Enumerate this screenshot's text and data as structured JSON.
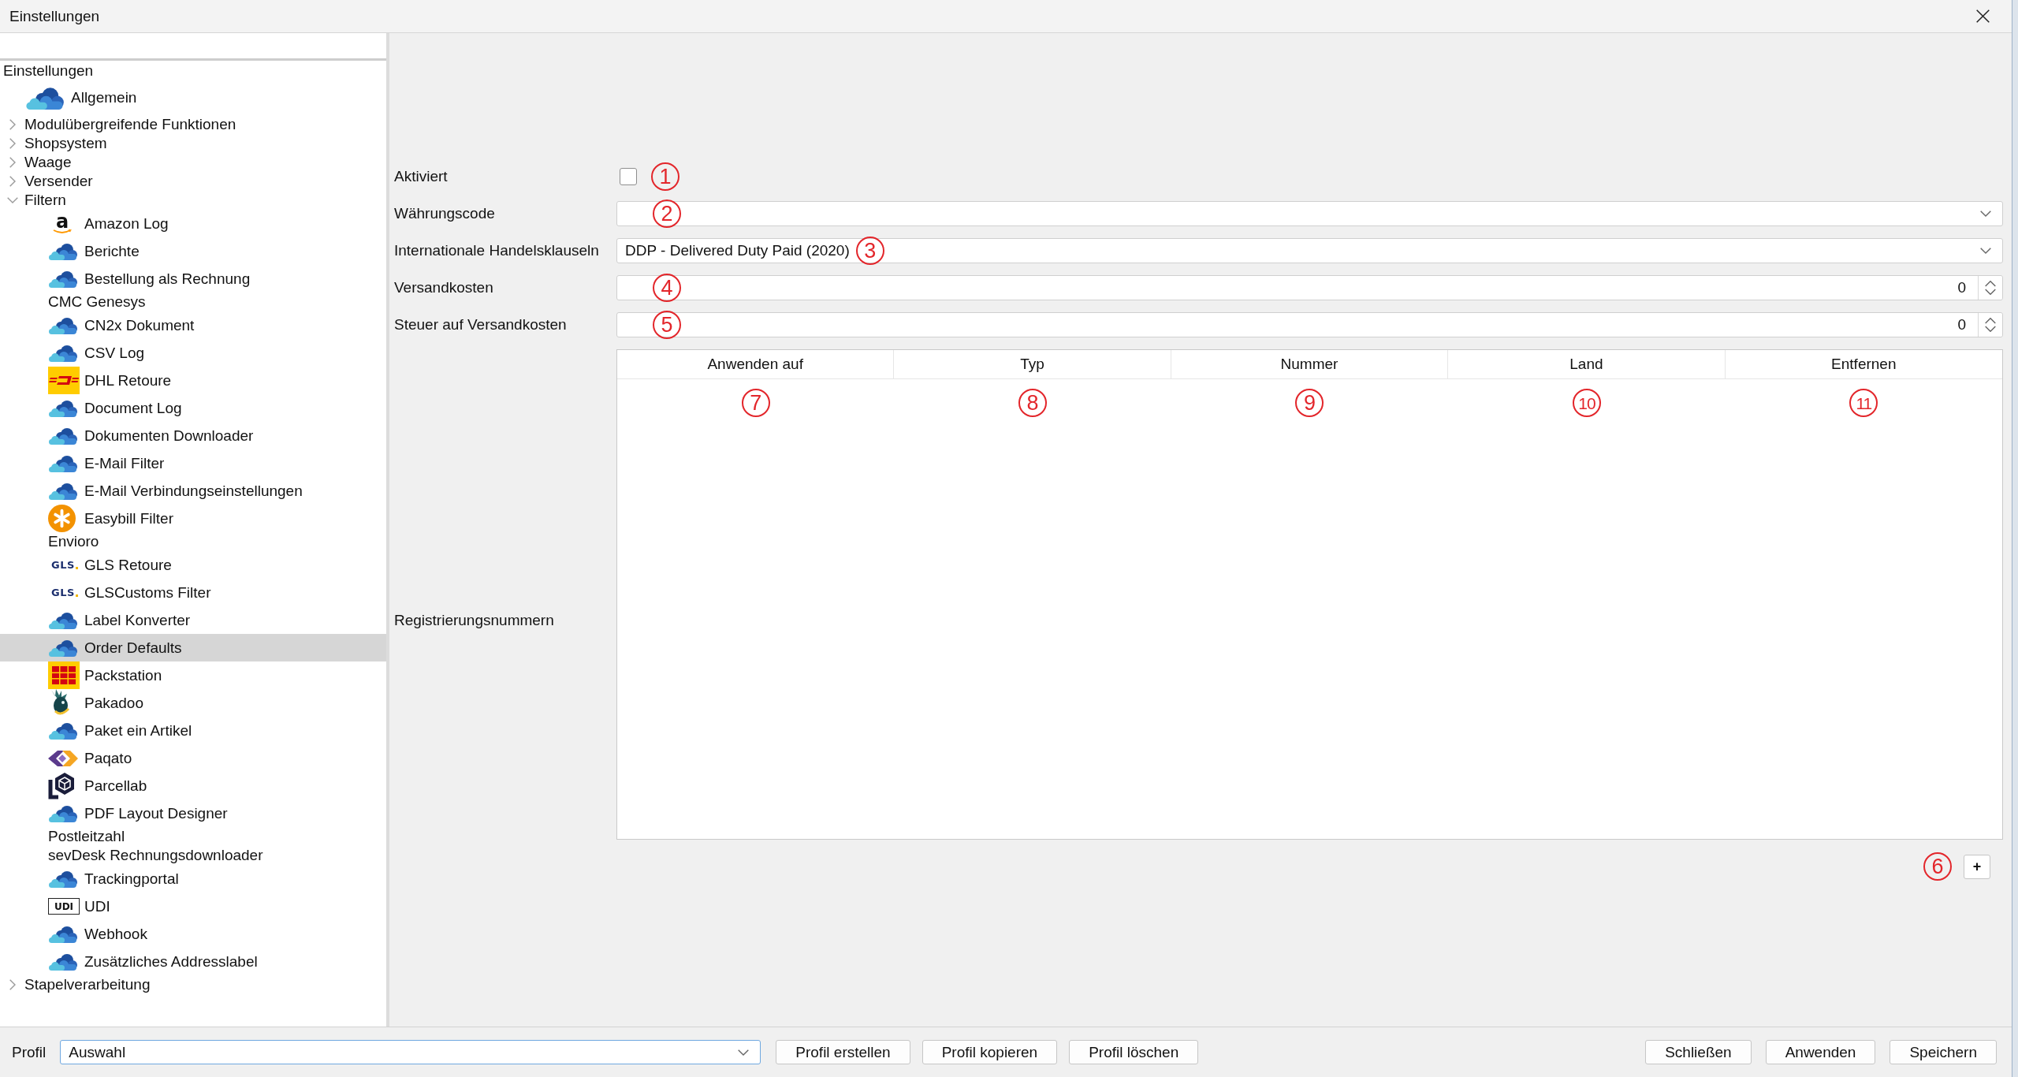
{
  "window": {
    "title": "Einstellungen"
  },
  "tree": {
    "label": "Einstellungen",
    "selected": false,
    "children": [
      {
        "label": "Allgemein",
        "kind": "cloud",
        "selected": false
      },
      {
        "label": "Modulübergreifende Funktionen",
        "kind": "group",
        "expanded": false,
        "selected": false
      },
      {
        "label": "Shopsystem",
        "kind": "group",
        "expanded": false,
        "selected": false
      },
      {
        "label": "Waage",
        "kind": "group",
        "expanded": false,
        "selected": false
      },
      {
        "label": "Versender",
        "kind": "group",
        "expanded": false,
        "selected": false
      },
      {
        "label": "Filtern",
        "kind": "group",
        "expanded": true,
        "selected": false,
        "children": [
          {
            "label": "Amazon Log",
            "kind": "letter",
            "logo_text": "a",
            "selected": false
          },
          {
            "label": "Berichte",
            "kind": "cloud",
            "selected": false
          },
          {
            "label": "Bestellung als Rechnung",
            "kind": "cloud",
            "selected": false
          },
          {
            "label": "CMC Genesys",
            "kind": "plain",
            "selected": false
          },
          {
            "label": "CN2x Dokument",
            "kind": "cloud",
            "selected": false
          },
          {
            "label": "CSV Log",
            "kind": "cloud",
            "selected": false
          },
          {
            "label": "DHL Retoure",
            "kind": "stripes",
            "selected": false
          },
          {
            "label": "Document Log",
            "kind": "cloud",
            "selected": false
          },
          {
            "label": "Dokumenten Downloader",
            "kind": "cloud",
            "selected": false
          },
          {
            "label": "E-Mail Filter",
            "kind": "cloud",
            "selected": false
          },
          {
            "label": "E-Mail Verbindungseinstellungen",
            "kind": "cloud",
            "selected": false
          },
          {
            "label": "Easybill Filter",
            "kind": "asterisk",
            "selected": false
          },
          {
            "label": "Envioro",
            "kind": "plain",
            "selected": false
          },
          {
            "label": "GLS Retoure",
            "kind": "wordmark",
            "logo_text": "GLS",
            "selected": false
          },
          {
            "label": "GLSCustoms Filter",
            "kind": "wordmark",
            "logo_text": "GLS",
            "selected": false
          },
          {
            "label": "Label Konverter",
            "kind": "cloud",
            "selected": false
          },
          {
            "label": "Order Defaults",
            "kind": "cloud",
            "selected": true
          },
          {
            "label": "Packstation",
            "kind": "grid",
            "selected": false
          },
          {
            "label": "Pakadoo",
            "kind": "bird",
            "selected": false
          },
          {
            "label": "Paket ein Artikel",
            "kind": "cloud",
            "selected": false
          },
          {
            "label": "Paqato",
            "kind": "chevron",
            "selected": false
          },
          {
            "label": "Parcellab",
            "kind": "cube",
            "selected": false
          },
          {
            "label": "PDF Layout Designer",
            "kind": "cloud",
            "selected": false
          },
          {
            "label": "Postleitzahl",
            "kind": "plain",
            "selected": false
          },
          {
            "label": "sevDesk Rechnungsdownloader",
            "kind": "plain",
            "selected": false
          },
          {
            "label": "Trackingportal",
            "kind": "cloud",
            "selected": false
          },
          {
            "label": "UDI",
            "kind": "tag",
            "logo_text": "UDI",
            "selected": false
          },
          {
            "label": "Webhook",
            "kind": "cloud",
            "selected": false
          },
          {
            "label": "Zusätzliches Addresslabel",
            "kind": "cloud",
            "selected": false
          }
        ]
      },
      {
        "label": "Stapelverarbeitung",
        "kind": "group",
        "expanded": false,
        "selected": false
      }
    ]
  },
  "settings_form": {
    "fields": [
      {
        "label": "Aktiviert",
        "kind": "checkbox",
        "checked": false,
        "marker": "1"
      },
      {
        "label": "Währungscode",
        "kind": "combo",
        "marker": "2"
      },
      {
        "label": "Internationale Handelsklauseln",
        "kind": "combo",
        "value": "DDP - Delivered Duty Paid (2020)",
        "marker": "3"
      },
      {
        "label": "Versandkosten",
        "kind": "spin",
        "value": "0",
        "marker": "4"
      },
      {
        "label": "Steuer auf Versandkosten",
        "kind": "spin",
        "value": "0",
        "marker": "5"
      }
    ],
    "registration_numbers": {
      "label": "Registrierungsnummern",
      "columns": [
        {
          "label": "Anwenden auf",
          "marker": "7"
        },
        {
          "label": "Typ",
          "marker": "8"
        },
        {
          "label": "Nummer",
          "marker": "9"
        },
        {
          "label": "Land",
          "marker": "10"
        },
        {
          "label": "Entfernen",
          "marker": "11"
        }
      ],
      "add_button": {
        "label": "+",
        "marker": "6"
      }
    }
  },
  "bottom_bar": {
    "profile": {
      "label": "Profil",
      "value": "Auswahl",
      "focused": true
    },
    "profile_buttons": [
      "Profil erstellen",
      "Profil kopieren",
      "Profil löschen"
    ],
    "dialog_buttons": [
      "Schließen",
      "Anwenden",
      "Speichern"
    ]
  }
}
